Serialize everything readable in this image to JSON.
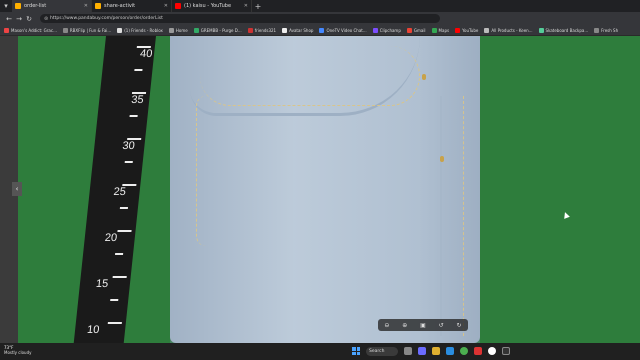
{
  "browser": {
    "tabs": [
      {
        "title": "order-list",
        "active": true,
        "icon": "pandabuy-favicon"
      },
      {
        "title": "share-activit",
        "active": false,
        "icon": "pandabuy-favicon"
      },
      {
        "title": "(1) kaisu - YouTube",
        "active": false,
        "icon": "youtube-favicon"
      }
    ],
    "new_tab": "+",
    "url": "https://www.pandabuy.com/person/order/orderList",
    "bookmarks": [
      "Mason's Addict: Grac...",
      "RBXFlip | Fun & Fai...",
      "(1) Friends - Roblox",
      "Home",
      "GREMBB - Purge D...",
      "friends321",
      "Avatar Shop",
      "OneTV Video Chat...",
      "Clipchamp",
      "Gmail",
      "Maps",
      "YouTube",
      "All Products - Keen...",
      "Skateboard Backpa...",
      "Fresh Sh"
    ]
  },
  "photo": {
    "ruler_numbers": [
      "40",
      "35",
      "30",
      "25",
      "20",
      "15",
      "10"
    ],
    "controls": [
      "zoom-out-icon",
      "zoom-in-icon",
      "fit-icon",
      "rotate-left-icon",
      "rotate-right-icon"
    ],
    "prev_arrow": "‹"
  },
  "taskbar": {
    "temperature": "73°F",
    "weather": "Mostly cloudy",
    "search_label": "Search"
  },
  "colors": {
    "background_green": "#2e7d3c",
    "denim": "#b7c6d6"
  }
}
